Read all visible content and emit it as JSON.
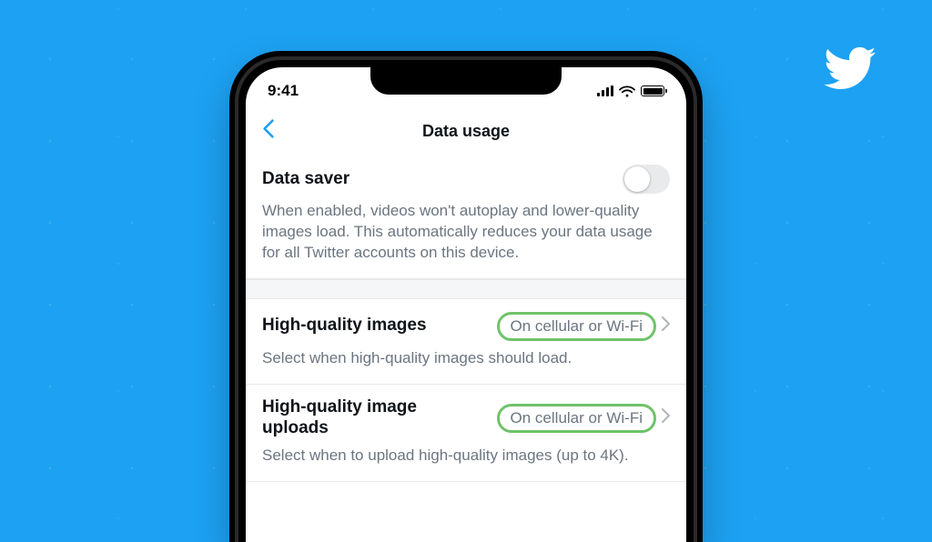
{
  "brand": {
    "name": "twitter-bird-icon"
  },
  "status": {
    "time": "9:41"
  },
  "navbar": {
    "title": "Data usage",
    "back_icon": "chevron-left-icon"
  },
  "sections": {
    "data_saver": {
      "label": "Data saver",
      "description": "When enabled, videos won't autoplay and lower-quality images load. This automatically reduces your data usage for all Twitter accounts on this device.",
      "enabled": false
    },
    "hq_images": {
      "label": "High-quality images",
      "value": "On cellular or Wi-Fi",
      "description": "Select when high-quality images should load."
    },
    "hq_uploads": {
      "label": "High-quality image uploads",
      "value": "On cellular or Wi-Fi",
      "description": "Select when to upload high-quality images (up to 4K)."
    }
  },
  "colors": {
    "accent": "#1DA1F2",
    "highlight_ring": "#6FC36A",
    "text_primary": "#0F1419",
    "text_secondary": "#6B7580"
  }
}
